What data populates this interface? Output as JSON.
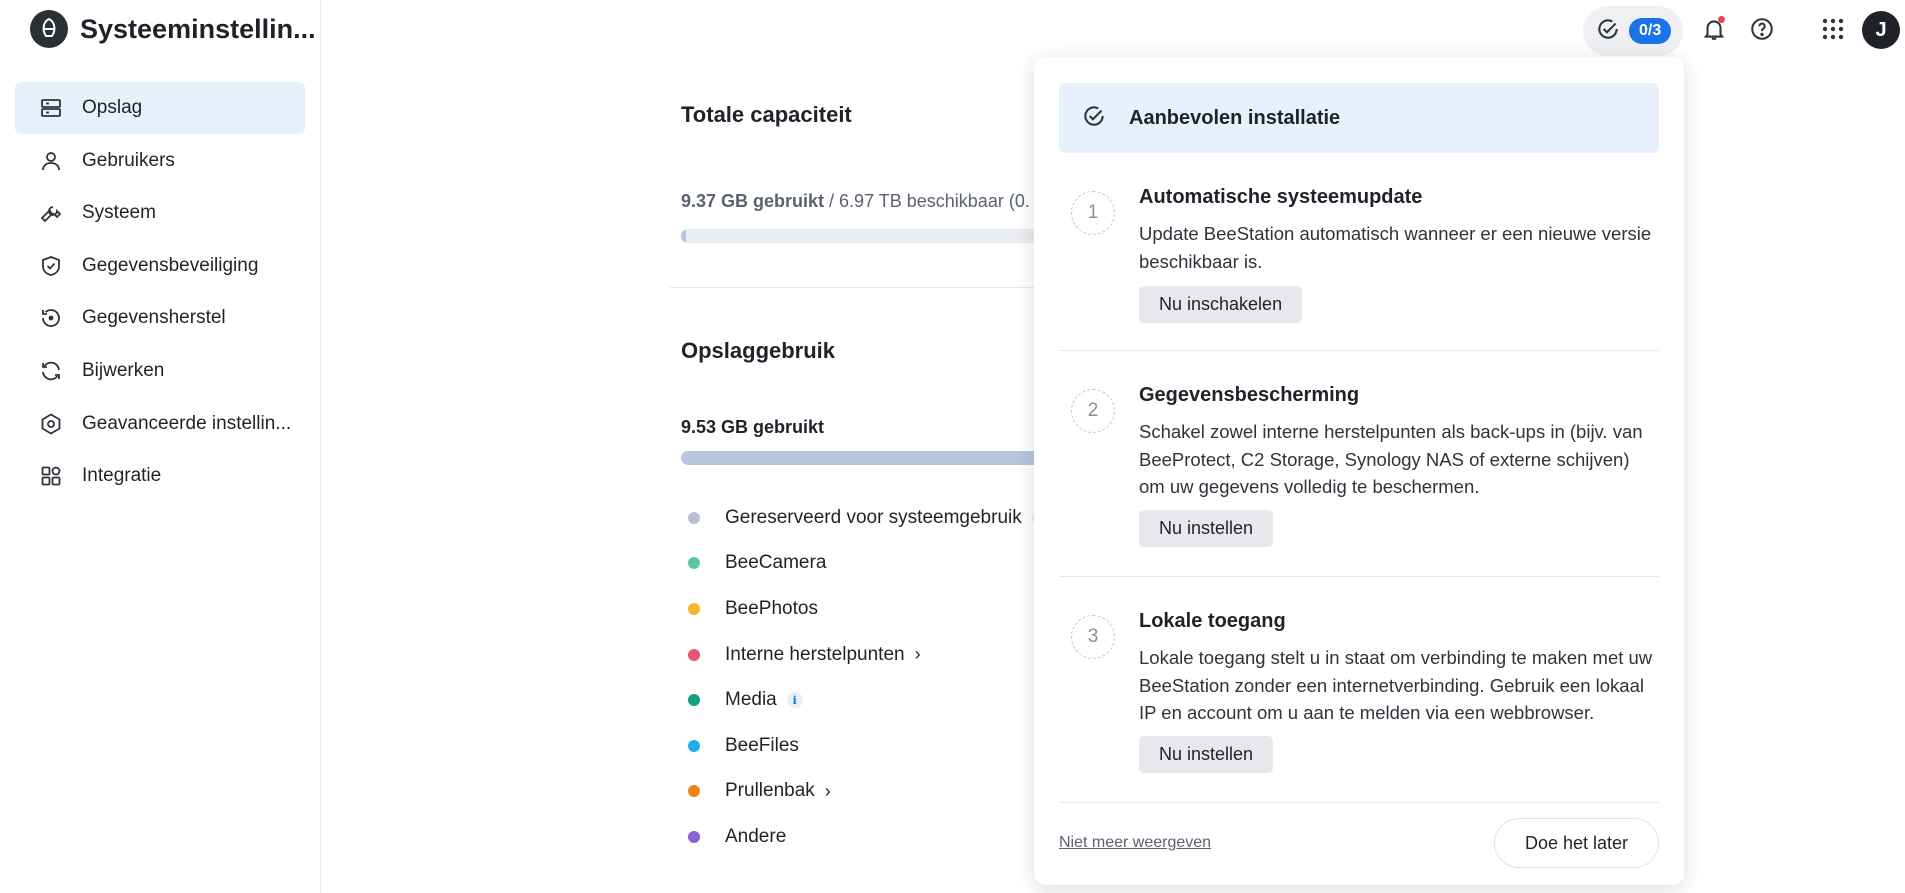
{
  "app": {
    "title": "Systeeminstellin..."
  },
  "sidebar": {
    "items": [
      {
        "label": "Opslag",
        "icon": "storage-icon",
        "active": true
      },
      {
        "label": "Gebruikers",
        "icon": "user-icon",
        "active": false
      },
      {
        "label": "Systeem",
        "icon": "wrench-icon",
        "active": false
      },
      {
        "label": "Gegevensbeveiliging",
        "icon": "shield-check-icon",
        "active": false
      },
      {
        "label": "Gegevensherstel",
        "icon": "restore-icon",
        "active": false
      },
      {
        "label": "Bijwerken",
        "icon": "refresh-icon",
        "active": false
      },
      {
        "label": "Geavanceerde instellin...",
        "icon": "advanced-settings-icon",
        "active": false
      },
      {
        "label": "Integratie",
        "icon": "integration-icon",
        "active": false
      }
    ]
  },
  "header": {
    "setup_badge": "0/3",
    "avatar_initial": "J"
  },
  "main": {
    "total_capacity": {
      "title": "Totale capaciteit",
      "used": "9.37 GB gebruikt",
      "available": " / 6.97 TB beschikbaar (0."
    },
    "storage_usage": {
      "title": "Opslaggebruik",
      "used": "9.53 GB gebruikt",
      "legend": [
        {
          "label": "Gereserveerd voor systeemgebruik",
          "color": "#b8c2d1",
          "info": true,
          "chevron": false
        },
        {
          "label": "BeeCamera",
          "color": "#5cc5a8",
          "info": false,
          "chevron": false
        },
        {
          "label": "BeePhotos",
          "color": "#f2b82a",
          "info": false,
          "chevron": false
        },
        {
          "label": "Interne herstelpunten",
          "color": "#e5566d",
          "info": false,
          "chevron": true
        },
        {
          "label": "Media",
          "color": "#12a37f",
          "info": true,
          "chevron": false
        },
        {
          "label": "BeeFiles",
          "color": "#20aee6",
          "info": false,
          "chevron": false
        },
        {
          "label": "Prullenbak",
          "color": "#f0831e",
          "info": false,
          "chevron": true
        },
        {
          "label": "Andere",
          "color": "#8a63d2",
          "info": false,
          "chevron": false
        }
      ]
    }
  },
  "popover": {
    "header": "Aanbevolen installatie",
    "steps": [
      {
        "number": "1",
        "title": "Automatische systeemupdate",
        "description": "Update BeeStation automatisch wanneer er een nieuwe versie beschikbaar is.",
        "button": "Nu inschakelen"
      },
      {
        "number": "2",
        "title": "Gegevensbescherming",
        "description": "Schakel zowel interne herstelpunten als back-ups in (bijv. van BeeProtect, C2 Storage, Synology NAS of externe schijven) om uw gegevens volledig te beschermen.",
        "button": "Nu instellen"
      },
      {
        "number": "3",
        "title": "Lokale toegang",
        "description": "Lokale toegang stelt u in staat om verbinding te maken met uw BeeStation zonder een internetverbinding. Gebruik een lokaal IP en account om u aan te melden via een webbrowser.",
        "button": "Nu instellen"
      }
    ],
    "dont_show": "Niet meer weergeven",
    "later": "Doe het later"
  }
}
